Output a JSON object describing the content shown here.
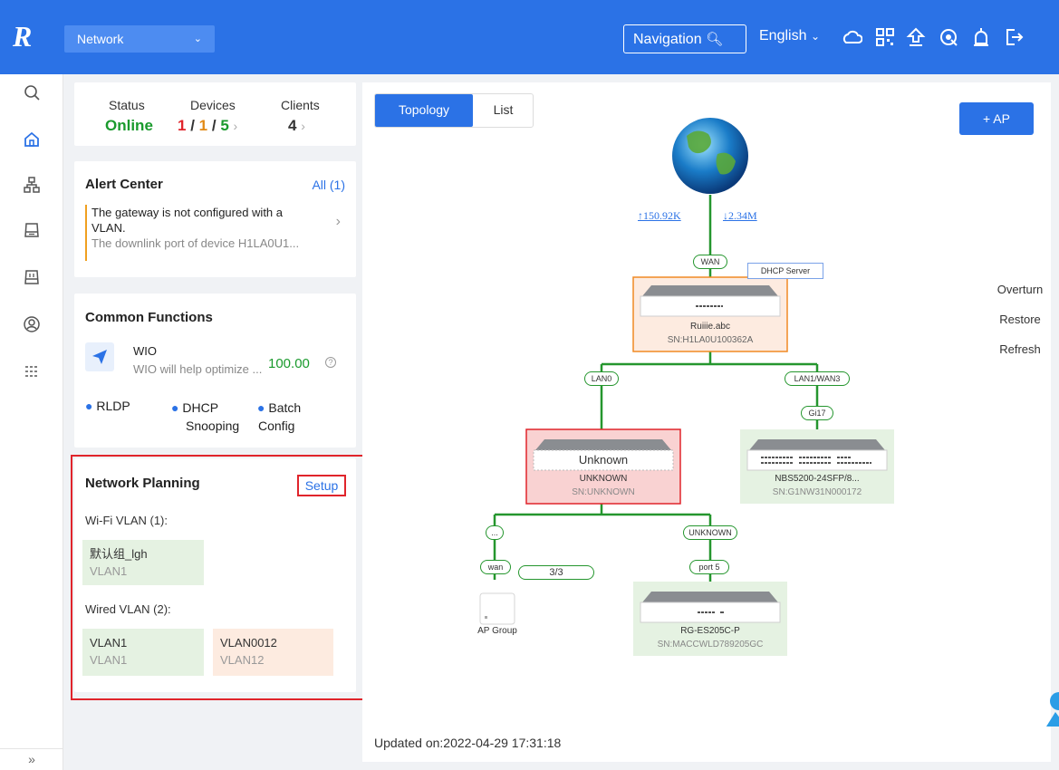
{
  "topbar": {
    "logo": "R",
    "network_label": "Network",
    "navigation_label": "Navigation",
    "language": "English"
  },
  "status": {
    "status_label": "Status",
    "status_value": "Online",
    "devices_label": "Devices",
    "devices_a": "1",
    "devices_b": "1",
    "devices_c": "5",
    "clients_label": "Clients",
    "clients_value": "4"
  },
  "alert": {
    "title": "Alert Center",
    "all_label": "All (1)",
    "line1": "The gateway is not configured with a",
    "line2": "VLAN.",
    "line3": "The downlink port of device H1LA0U1..."
  },
  "common": {
    "title": "Common Functions",
    "wio_title": "WIO",
    "wio_desc": "WIO will help optimize ...",
    "wio_score": "100.00",
    "rldp": "RLDP",
    "dhcp1": "DHCP",
    "dhcp2": "Snooping",
    "batch1": "Batch",
    "batch2": "Config"
  },
  "planning": {
    "title": "Network Planning",
    "setup": "Setup",
    "wifi_label": "Wi-Fi VLAN (1):",
    "wifi_vlans": [
      {
        "name": "默认组_lgh",
        "vlan": "VLAN1"
      }
    ],
    "wired_label": "Wired VLAN (2):",
    "wired_vlans": [
      {
        "name": "VLAN1",
        "vlan": "VLAN1"
      },
      {
        "name": "VLAN0012",
        "vlan": "VLAN12"
      }
    ]
  },
  "view": {
    "tab_topology": "Topology",
    "tab_list": "List",
    "add_ap": "+ AP",
    "overturn": "Overturn",
    "restore": "Restore",
    "refresh": "Refresh",
    "updated": "Updated on:2022-04-29 17:31:18"
  },
  "topology": {
    "upload": "↑150.92K",
    "download": "↓2.34M",
    "wan_tag": "WAN",
    "dhcp_server": "DHCP Server",
    "gateway_name": "Ruiiie.abc",
    "gateway_sn": "SN:H1LA0U100362A",
    "lan0_tag": "LAN0",
    "lan1_tag": "LAN1/WAN3",
    "gi17_tag": "Gi17",
    "unknown_title": "Unknown",
    "unknown_name": "UNKNOWN",
    "unknown_sn": "SN:UNKNOWN",
    "nbs_name": "NBS5200-24SFP/8...",
    "nbs_sn": "SN:G1NW31N000172",
    "dots_tag": "...",
    "unknown_tag": "UNKNOWN",
    "wan_small_tag": "wan",
    "ap_count": "3/3",
    "port5_tag": "port 5",
    "ap_group": "AP Group",
    "es_name": "RG-ES205C-P",
    "es_sn": "SN:MACCWLD789205GC"
  },
  "colors": {
    "brand_blue": "#2b72e6",
    "online_green": "#1a9a2d",
    "link_green": "#25962e",
    "alert_red": "#e0242b",
    "gateway_border": "#f08a24"
  }
}
